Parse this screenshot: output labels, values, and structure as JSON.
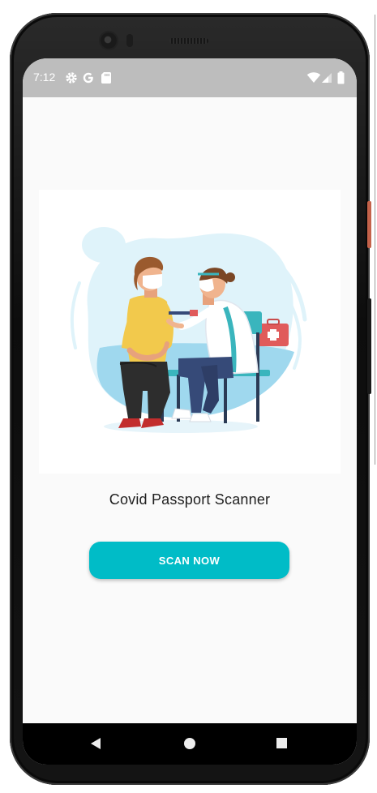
{
  "status_bar": {
    "time": "7:12",
    "icons": [
      "settings-icon",
      "google-icon",
      "sd-card-icon",
      "wifi-icon",
      "signal-icon",
      "battery-icon"
    ]
  },
  "main": {
    "illustration": "vaccination-illustration",
    "title": "Covid Passport Scanner",
    "scan_button_label": "SCAN NOW"
  },
  "nav_bar": {
    "icons": [
      "back-icon",
      "home-icon",
      "recents-icon"
    ]
  },
  "colors": {
    "accent": "#00bcc7",
    "status_bar": "#bdbdbd",
    "background": "#fafafa",
    "nav_bar": "#000000"
  }
}
